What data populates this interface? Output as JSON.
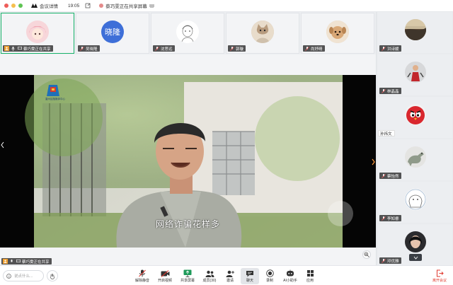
{
  "titlebar": {
    "meeting_details_label": "会议详情",
    "time": "19:05",
    "sharing_status": "蔡巧雯正在共享屏幕",
    "traffic_colors": [
      "#ee5d5a",
      "#f5bf4f",
      "#5fc454"
    ]
  },
  "gallery": [
    {
      "name": "蔡巧雯正在共享",
      "avatar": "anime-girl-avatar",
      "avatar_text": "",
      "active": true
    },
    {
      "name": "吴晓隆",
      "avatar": "text-avatar",
      "avatar_text": "晓隆",
      "active": false
    },
    {
      "name": "沈思远",
      "avatar": "sketch-avatar",
      "avatar_text": "",
      "active": false
    },
    {
      "name": "郭璇",
      "avatar": "cat-avatar",
      "avatar_text": "",
      "active": false
    },
    {
      "name": "尚妤晴",
      "avatar": "dog-avatar",
      "avatar_text": "",
      "active": false
    }
  ],
  "right_panel": [
    {
      "name": "洪诗媛",
      "avatar": "landscape-avatar"
    },
    {
      "name": "林晶晶",
      "avatar": "figure-avatar"
    },
    {
      "name": "孙祎文",
      "avatar": "red-bird-avatar"
    },
    {
      "name": "蔡怡然",
      "avatar": "dinosaur-avatar"
    },
    {
      "name": "李知睿",
      "avatar": "sketch-girl-avatar"
    },
    {
      "name": "邓优雅",
      "avatar": "portrait-avatar"
    }
  ],
  "video": {
    "subtitle": "网络诈骗花样多",
    "logo_text": "襄州区融媒体中心",
    "sharer_label": "蔡巧雯正在共享"
  },
  "chat": {
    "placeholder": "说点什么..."
  },
  "toolbar": {
    "tools": [
      {
        "label": "解除静音",
        "icon": "mic-muted-icon"
      },
      {
        "label": "开启视频",
        "icon": "camera-off-icon"
      },
      {
        "label": "共享屏幕",
        "icon": "share-screen-icon"
      },
      {
        "label": "成员(30)",
        "icon": "members-icon"
      },
      {
        "label": "邀请",
        "icon": "invite-icon"
      },
      {
        "label": "聊天",
        "icon": "chat-icon"
      },
      {
        "label": "录制",
        "icon": "record-icon"
      },
      {
        "label": "AI小助手",
        "icon": "ai-assistant-icon"
      },
      {
        "label": "应用",
        "icon": "apps-icon"
      }
    ],
    "leave_label": "离开会议"
  },
  "colors": {
    "accent_green": "#17b26a",
    "leave_red": "#e03a2f",
    "avatar_blue": "#3e6fd8"
  }
}
